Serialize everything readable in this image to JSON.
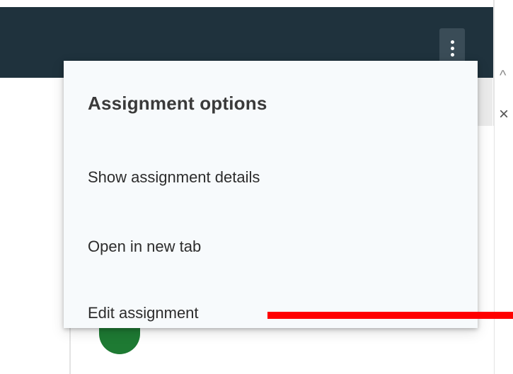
{
  "menu": {
    "title": "Assignment options",
    "items": [
      {
        "label": "Show assignment details"
      },
      {
        "label": "Open in new tab"
      },
      {
        "label": "Edit assignment"
      }
    ]
  },
  "icons": {
    "more": "more-vert-icon",
    "caret": "chevron-up-icon",
    "close": "close-icon"
  },
  "side": {
    "caret_glyph": "^",
    "close_glyph": "×"
  },
  "colors": {
    "header": "#1f323d",
    "menu_bg": "#f7fafc",
    "annotation": "#ff0000",
    "avatar": "#1e7a33"
  }
}
